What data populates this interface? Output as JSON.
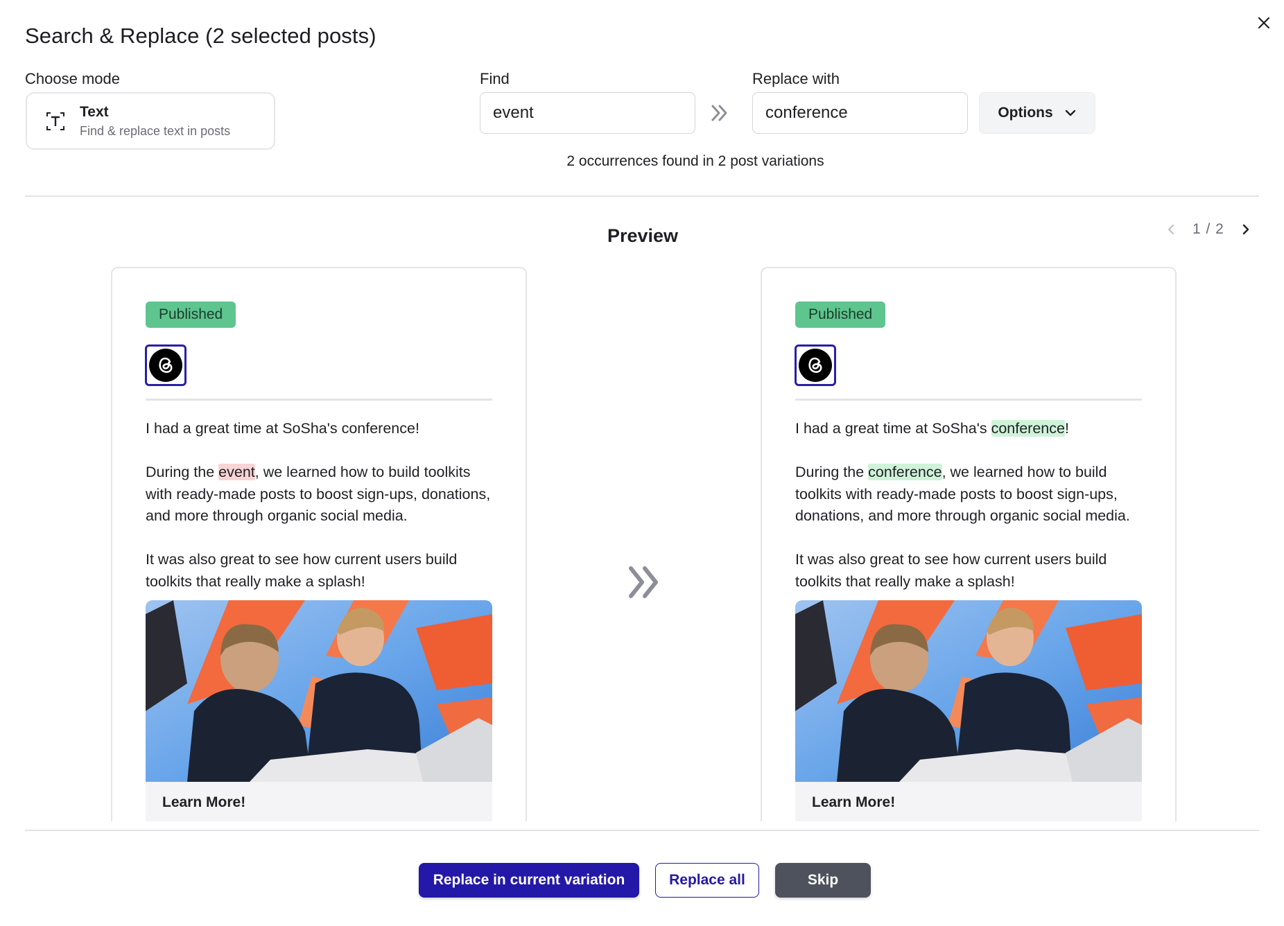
{
  "modal": {
    "title": "Search & Replace (2 selected posts)"
  },
  "mode": {
    "label": "Choose mode",
    "title": "Text",
    "description": "Find & replace text in posts",
    "icon": "text-mode-icon"
  },
  "find": {
    "label": "Find",
    "value": "event"
  },
  "replace": {
    "label": "Replace with",
    "value": "conference"
  },
  "options": {
    "label": "Options"
  },
  "occurrences": "2 occurrences found in 2 post variations",
  "preview": {
    "title": "Preview",
    "pager": "1 / 2"
  },
  "before": {
    "status": "Published",
    "network": "threads-icon",
    "p1": "I had a great time at SoSha's conference!",
    "p2_pre": "During the ",
    "p2_match": "event",
    "p2_post": ", we learned how to build toolkits with ready-made posts to boost sign-ups, donations, and more through organic social media.",
    "p3": "It was also great to see how current users build toolkits that really make a splash!",
    "link": "Learn More!"
  },
  "after": {
    "status": "Published",
    "network": "threads-icon",
    "p1_pre": "I had a great time at SoSha's ",
    "p1_match": "conference",
    "p1_post": "!",
    "p2_pre": "During the ",
    "p2_match": "conference",
    "p2_post": ", we learned how to build toolkits with ready-made posts to boost sign-ups, donations, and more through organic social media.",
    "p3": "It was also great to see how current users build toolkits that really make a splash!",
    "link": "Learn More!"
  },
  "footer": {
    "replace_current": "Replace in current variation",
    "replace_all": "Replace all",
    "skip": "Skip"
  },
  "colors": {
    "primary": "#2318a8",
    "published": "#5ec58f",
    "highlight_old": "#f8d4d4",
    "highlight_new": "#cff3d9",
    "skip": "#4d525c"
  }
}
